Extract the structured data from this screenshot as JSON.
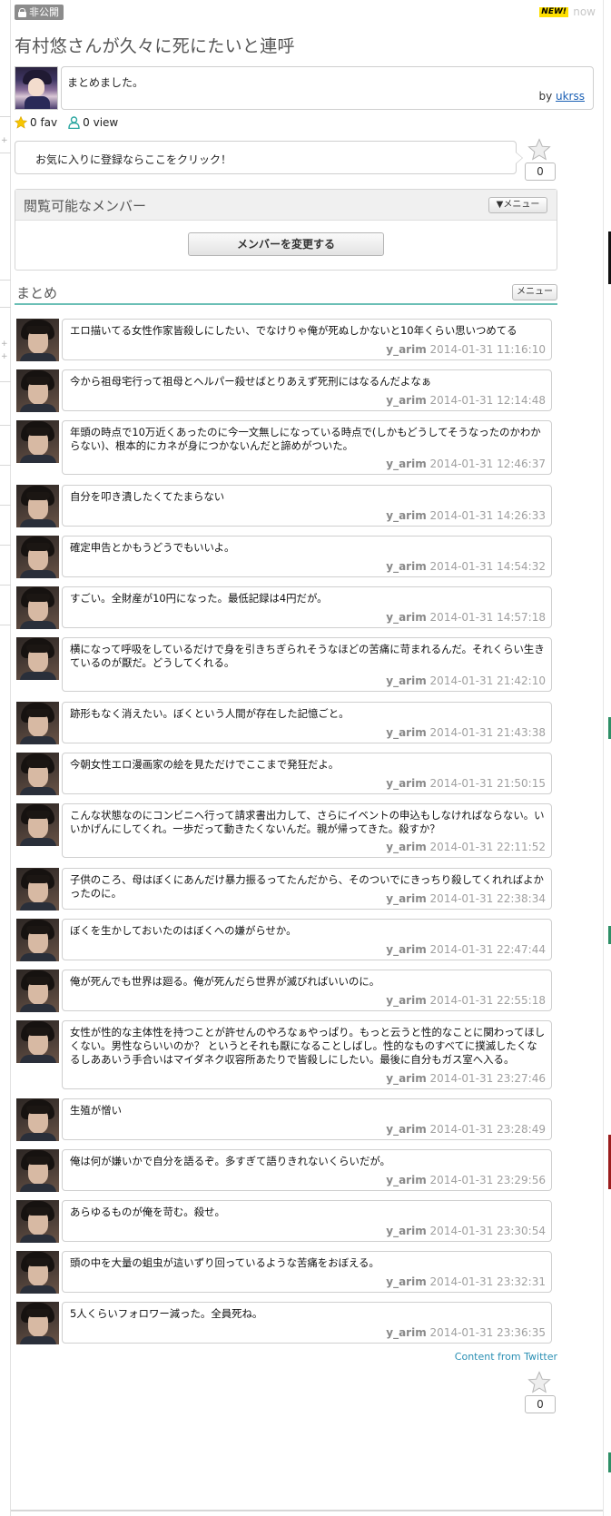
{
  "header": {
    "private_label": "非公開",
    "new_badge": "NEW!",
    "now_label": "now"
  },
  "page": {
    "title": "有村悠さんが久々に死にたいと連呼"
  },
  "summary": {
    "text": "まとめました。",
    "by_prefix": "by",
    "author": "ukrss"
  },
  "stats": {
    "fav": "0 fav",
    "view": "0 view"
  },
  "favorite": {
    "prompt": "お気に入りに登録ならここをクリック！",
    "count": "0"
  },
  "members": {
    "title": "閲覧可能なメンバー",
    "menu_label": "▼メニュー",
    "change_button": "メンバーを変更する"
  },
  "matome": {
    "title": "まとめ",
    "menu_label": "メニュー"
  },
  "tweets": [
    {
      "text": "エロ描いてる女性作家皆殺しにしたい、でなけりゃ俺が死ぬしかないと10年くらい思いつめてる",
      "user": "y_arim",
      "time": "2014-01-31 11:16:10"
    },
    {
      "text": "今から祖母宅行って祖母とヘルパー殺せばとりあえず死刑にはなるんだよなぁ",
      "user": "y_arim",
      "time": "2014-01-31 12:14:48"
    },
    {
      "text": "年頭の時点で10万近くあったのに今一文無しになっている時点で(しかもどうしてそうなったのかわからない)、根本的にカネが身につかないんだと諦めがついた。",
      "user": "y_arim",
      "time": "2014-01-31 12:46:37"
    },
    {
      "text": "自分を叩き潰したくてたまらない",
      "user": "y_arim",
      "time": "2014-01-31 14:26:33"
    },
    {
      "text": "確定申告とかもうどうでもいいよ。",
      "user": "y_arim",
      "time": "2014-01-31 14:54:32"
    },
    {
      "text": "すごい。全財産が10円になった。最低記録は4円だが。",
      "user": "y_arim",
      "time": "2014-01-31 14:57:18"
    },
    {
      "text": "横になって呼吸をしているだけで身を引きちぎられそうなほどの苦痛に苛まれるんだ。それくらい生きているのが厭だ。どうしてくれる。",
      "user": "y_arim",
      "time": "2014-01-31 21:42:10"
    },
    {
      "text": "跡形もなく消えたい。ぼくという人間が存在した記憶ごと。",
      "user": "y_arim",
      "time": "2014-01-31 21:43:38"
    },
    {
      "text": "今朝女性エロ漫画家の絵を見ただけでここまで発狂だよ。",
      "user": "y_arim",
      "time": "2014-01-31 21:50:15"
    },
    {
      "text": "こんな状態なのにコンビニへ行って請求書出力して、さらにイベントの申込もしなければならない。いいかげんにしてくれ。一歩だって動きたくないんだ。親が帰ってきた。殺すか？",
      "user": "y_arim",
      "time": "2014-01-31 22:11:52"
    },
    {
      "text": "子供のころ、母はぼくにあんだけ暴力振るってたんだから、そのついでにきっちり殺してくれればよかったのに。",
      "user": "y_arim",
      "time": "2014-01-31 22:38:34"
    },
    {
      "text": "ぼくを生かしておいたのはぼくへの嫌がらせか。",
      "user": "y_arim",
      "time": "2014-01-31 22:47:44"
    },
    {
      "text": "俺が死んでも世界は廻る。俺が死んだら世界が滅びればいいのに。",
      "user": "y_arim",
      "time": "2014-01-31 22:55:18"
    },
    {
      "text": "女性が性的な主体性を持つことが許せんのやろなぁやっぱり。もっと云うと性的なことに関わってほしくない。男性ならいいのか？ というとそれも厭になることしばし。性的なものすべてに撲滅したくなるしああいう手合いはマイダネク収容所あたりで皆殺しにしたい。最後に自分もガス室へ入る。",
      "user": "y_arim",
      "time": "2014-01-31 23:27:46"
    },
    {
      "text": "生殖が憎い",
      "user": "y_arim",
      "time": "2014-01-31 23:28:49"
    },
    {
      "text": "俺は何が嫌いかで自分を語るぞ。多すぎて語りきれないくらいだが。",
      "user": "y_arim",
      "time": "2014-01-31 23:29:56"
    },
    {
      "text": "あらゆるものが俺を苛む。殺せ。",
      "user": "y_arim",
      "time": "2014-01-31 23:30:54"
    },
    {
      "text": "頭の中を大量の蛆虫が這いずり回っているような苦痛をおぼえる。",
      "user": "y_arim",
      "time": "2014-01-31 23:32:31"
    },
    {
      "text": "5人くらいフォロワー減った。全員死ね。",
      "user": "y_arim",
      "time": "2014-01-31 23:36:35"
    }
  ],
  "footer": {
    "source": "Content from Twitter",
    "count": "0"
  },
  "colors": {
    "accent_teal": "#6bbfb6",
    "link_blue": "#1a5fb4",
    "timestamp_gray": "#a0a0a0",
    "star_yellow": "#f7c600"
  }
}
